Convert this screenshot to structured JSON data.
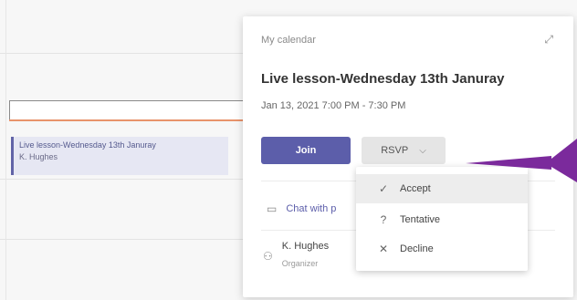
{
  "event_block": {
    "title": "Live lesson-Wednesday 13th Januray",
    "organizer": "K. Hughes"
  },
  "card": {
    "calendar_label": "My calendar",
    "title": "Live lesson-Wednesday 13th Januray",
    "datetime": "Jan 13, 2021 7:00 PM - 7:30 PM",
    "join_label": "Join",
    "rsvp_label": "RSVP",
    "chat_label": "Chat with p",
    "organizer_name": "K. Hughes",
    "organizer_role": "Organizer"
  },
  "rsvp_menu": {
    "items": [
      {
        "label": "Accept",
        "icon": "✓",
        "selected": true
      },
      {
        "label": "Tentative",
        "icon": "?",
        "selected": false
      },
      {
        "label": "Decline",
        "icon": "✕",
        "selected": false
      }
    ]
  },
  "colors": {
    "accent": "#5c5eaa",
    "now_line": "#e8936b",
    "annotation_arrow": "#7b2a9c"
  },
  "icons": {
    "expand": "expand-icon",
    "chat": "chat-icon",
    "person": "person-icon",
    "chevron": "chevron-down-icon"
  }
}
